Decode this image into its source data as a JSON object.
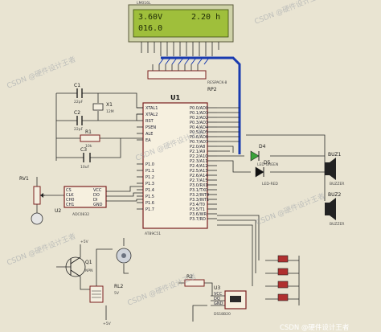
{
  "lcd": {
    "line1_left": "3.60V",
    "line1_right": "2.20 h",
    "line2": "016.0",
    "label": "LM016L"
  },
  "u1": {
    "ref": "U1",
    "part": "AT89C51",
    "left_pins": [
      "XTAL1",
      "XTAL2",
      "RST",
      "PSEN",
      "ALE",
      "EA",
      "P1.0",
      "P1.1",
      "P1.2",
      "P1.3",
      "P1.4",
      "P1.5",
      "P1.6",
      "P1.7"
    ],
    "right_pins": [
      "P0.0/AD0",
      "P0.1/AD1",
      "P0.2/AD2",
      "P0.3/AD3",
      "P0.4/AD4",
      "P0.5/AD5",
      "P0.6/AD6",
      "P0.7/AD7",
      "P2.0/A8",
      "P2.1/A9",
      "P2.2/A10",
      "P2.3/A11",
      "P2.4/A12",
      "P2.5/A13",
      "P2.6/A14",
      "P2.7/A15",
      "P3.0/RXD",
      "P3.1/TXD",
      "P3.2/INT0",
      "P3.3/INT1",
      "P3.4/T0",
      "P3.5/T1",
      "P3.6/WR",
      "P3.7/RD"
    ]
  },
  "rp2": {
    "ref": "RP2",
    "part": "RESPACK-8"
  },
  "crystal": {
    "ref": "X1",
    "value": "12M"
  },
  "c1": {
    "ref": "C1",
    "value": "22pF"
  },
  "c2": {
    "ref": "C2",
    "value": "22pF"
  },
  "c3": {
    "ref": "C3",
    "value": "10uF"
  },
  "r1": {
    "ref": "R1",
    "value": "10k"
  },
  "rv1": {
    "ref": "RV1"
  },
  "u2": {
    "ref": "U2",
    "part": "ADC0832",
    "pins": [
      "CS",
      "CLK",
      "CH0",
      "CH1",
      "VCC",
      "DO",
      "DI",
      "GND"
    ]
  },
  "d4": {
    "ref": "D4",
    "part": "LED-GREEN"
  },
  "d5": {
    "ref": "D5",
    "part": "LED-RED"
  },
  "buz1": {
    "ref": "BUZ1",
    "part": "BUZZER"
  },
  "buz2": {
    "ref": "BUZ2",
    "part": "BUZZER"
  },
  "q1": {
    "ref": "Q1",
    "part": "NPN"
  },
  "rl2": {
    "ref": "RL2",
    "value": "5V"
  },
  "r2": {
    "ref": "R2"
  },
  "u3": {
    "ref": "U3",
    "part": "DS18B20",
    "pins": [
      "VCC",
      "DQ",
      "GND"
    ]
  },
  "supply": {
    "plus5v": "+5V"
  },
  "watermark": {
    "text": "CSDN @硬件设计王者"
  }
}
